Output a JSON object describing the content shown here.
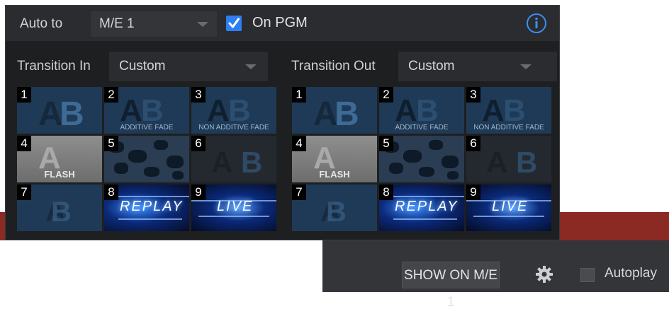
{
  "header": {
    "auto_to_label": "Auto to",
    "me_value": "M/E 1",
    "on_pgm_label": "On PGM",
    "on_pgm_checked": true
  },
  "transition_in": {
    "label": "Transition In",
    "value": "Custom",
    "selected_index": 8
  },
  "transition_out": {
    "label": "Transition Out",
    "value": "Custom",
    "selected_index": 9
  },
  "tiles": [
    {
      "num": "1",
      "caption": ""
    },
    {
      "num": "2",
      "caption": "ADDITIVE FADE"
    },
    {
      "num": "3",
      "caption": "NON ADDITIVE FADE"
    },
    {
      "num": "4",
      "caption": "FLASH"
    },
    {
      "num": "5",
      "caption": ""
    },
    {
      "num": "6",
      "caption": ""
    },
    {
      "num": "7",
      "caption": ""
    },
    {
      "num": "8",
      "caption": "REPLAY"
    },
    {
      "num": "9",
      "caption": "LIVE"
    }
  ],
  "bottom": {
    "show_on_label": "SHOW ON M/E 1",
    "autoplay_label": "Autoplay"
  },
  "colors": {
    "accent_blue": "#2d7ff2",
    "panel_bg": "#1e1f21",
    "strip_red": "#8a2a22"
  },
  "icons": [
    "info-icon",
    "chevron-down-icon",
    "gear-icon",
    "check-icon"
  ]
}
